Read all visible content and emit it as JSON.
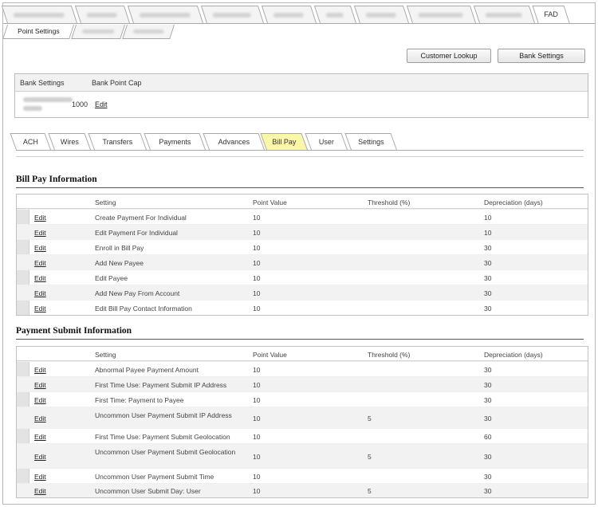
{
  "top_tabs": {
    "active_label": "FAD"
  },
  "sub_tabs": {
    "point_settings": "Point Settings"
  },
  "buttons": {
    "customer_lookup": "Customer Lookup",
    "bank_settings": "Bank Settings"
  },
  "bank": {
    "headers": [
      "Bank Settings",
      "Bank Point Cap"
    ],
    "point_cap": "1000",
    "edit": "Edit"
  },
  "category_tabs": [
    "ACH",
    "Wires",
    "Transfers",
    "Payments",
    "Advances",
    "Bill Pay",
    "User",
    "Settings"
  ],
  "active_category": "Bill Pay",
  "columns": [
    "Setting",
    "Point Value",
    "Threshold (%)",
    "Depreciation (days)"
  ],
  "bill_pay": {
    "title": "Bill Pay Information",
    "rows": [
      {
        "edit": "Edit",
        "setting": "Create Payment For Individual",
        "point": "10",
        "threshold": "",
        "dep": "10"
      },
      {
        "edit": "Edit",
        "setting": "Edit Payment For Individual",
        "point": "10",
        "threshold": "",
        "dep": "10"
      },
      {
        "edit": "Edit",
        "setting": "Enroll in Bill Pay",
        "point": "10",
        "threshold": "",
        "dep": "30"
      },
      {
        "edit": "Edit",
        "setting": "Add New Payee",
        "point": "10",
        "threshold": "",
        "dep": "30"
      },
      {
        "edit": "Edit",
        "setting": "Edit Payee",
        "point": "10",
        "threshold": "",
        "dep": "30"
      },
      {
        "edit": "Edit",
        "setting": "Add New Pay From Account",
        "point": "10",
        "threshold": "",
        "dep": "30"
      },
      {
        "edit": "Edit",
        "setting": "Edit Bill Pay Contact Information",
        "point": "10",
        "threshold": "",
        "dep": "30"
      }
    ]
  },
  "payment_submit": {
    "title": "Payment Submit Information",
    "rows": [
      {
        "edit": "Edit",
        "setting": "Abnormal Payee Payment Amount",
        "point": "10",
        "threshold": "",
        "dep": "30"
      },
      {
        "edit": "Edit",
        "setting": "First Time Use: Payment Submit IP Address",
        "point": "10",
        "threshold": "",
        "dep": "30"
      },
      {
        "edit": "Edit",
        "setting": "First Time: Payment to Payee",
        "point": "10",
        "threshold": "",
        "dep": "30"
      },
      {
        "edit": "Edit",
        "setting": "Uncommon User Payment Submit IP Address",
        "point": "10",
        "threshold": "5",
        "dep": "30"
      },
      {
        "edit": "Edit",
        "setting": "First Time Use: Payment Submit Geolocation",
        "point": "10",
        "threshold": "",
        "dep": "60"
      },
      {
        "edit": "Edit",
        "setting": "Uncommon User Payment Submit Geolocation",
        "point": "10",
        "threshold": "5",
        "dep": "30"
      },
      {
        "edit": "Edit",
        "setting": "Uncommon User Payment Submit Time",
        "point": "10",
        "threshold": "",
        "dep": "30"
      },
      {
        "edit": "Edit",
        "setting": "Uncommon User Submit Day: User",
        "point": "10",
        "threshold": "5",
        "dep": "30"
      }
    ]
  }
}
